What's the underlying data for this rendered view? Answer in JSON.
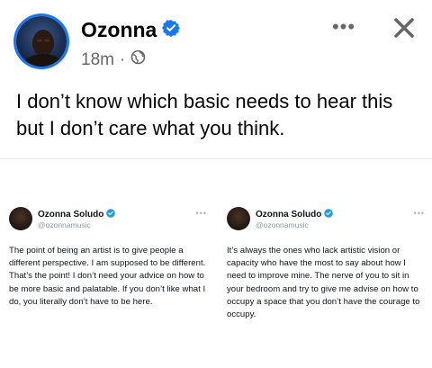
{
  "post": {
    "author": "Ozonna",
    "verified": true,
    "time": "18m",
    "separator": "·",
    "privacy_icon": "globe-icon",
    "more_label": "•••",
    "text": "I don’t know which basic needs to hear this but I don’t care what you think."
  },
  "colors": {
    "accent": "#1877f2",
    "secondary_text": "#65676b",
    "divider": "#e4e6eb"
  },
  "tweets": [
    {
      "name": "Ozonna Soludo",
      "handle": "@ozonnamusic",
      "dots": "•••",
      "body": "The point of being an artist is to give people a different perspective. I am supposed to be different. That’s the point! I don’t need your advice on how to be more basic and palatable. If you don’t like what I do, you literally don’t have to be here."
    },
    {
      "name": "Ozonna Soludo",
      "handle": "@ozonnamusic",
      "dots": "•••",
      "body": "It’s always the ones who lack artistic vision or capacity who have the most to say about how I need to improve mine. The nerve of you to sit in your bedroom and try to give me advise on how to occupy a space that you don’t have the courage to occupy."
    }
  ]
}
